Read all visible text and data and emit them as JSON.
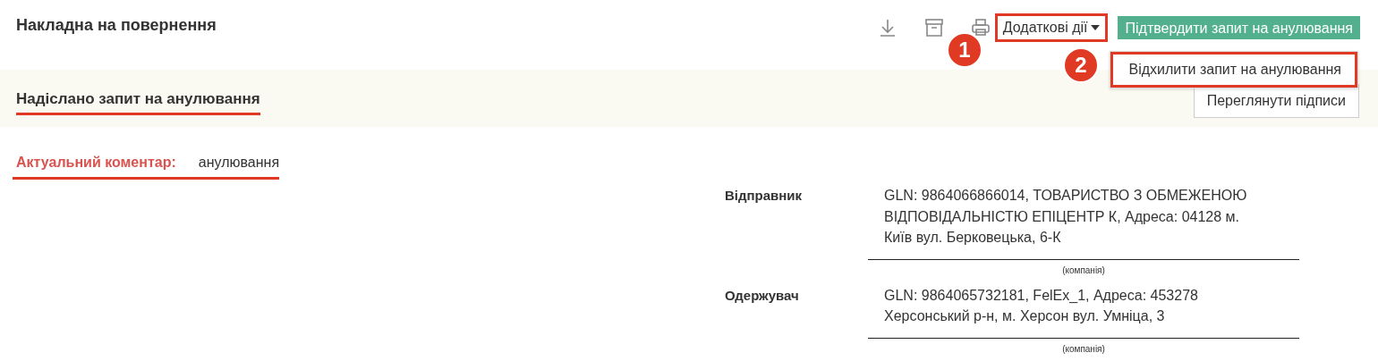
{
  "header": {
    "title": "Накладна на повернення",
    "actions_button": {
      "label": "Додаткові дії",
      "highlighted": true,
      "callout": "1"
    },
    "confirm_button": {
      "label": "Підтвердити запит на анулювання"
    }
  },
  "dropdown": {
    "open": true,
    "items": [
      {
        "label": "Відхилити запит на анулювання",
        "highlighted": true,
        "callout": "2"
      }
    ]
  },
  "status": {
    "text": "Надіслано запит на анулювання",
    "underlined": true,
    "signatures_button": "Переглянути підписи"
  },
  "comment": {
    "label": "Актуальний коментар:",
    "value": "анулювання",
    "underlined": true
  },
  "parties": [
    {
      "label": "Відправник",
      "value": "GLN: 9864066866014, ТОВАРИСТВО З ОБМЕЖЕНОЮ ВІДПОВІДАЛЬНІСТЮ ЕПІЦЕНТР К, Адреса: 04128 м. Київ вул. Берковецька, 6-К",
      "caption": "(компанія)"
    },
    {
      "label": "Одержувач",
      "value": "GLN: 9864065732181, FelEx_1, Адреса: 453278 Херсонський р-н, м. Херсон вул. Умніца, 3",
      "caption": "(компанія)"
    }
  ]
}
